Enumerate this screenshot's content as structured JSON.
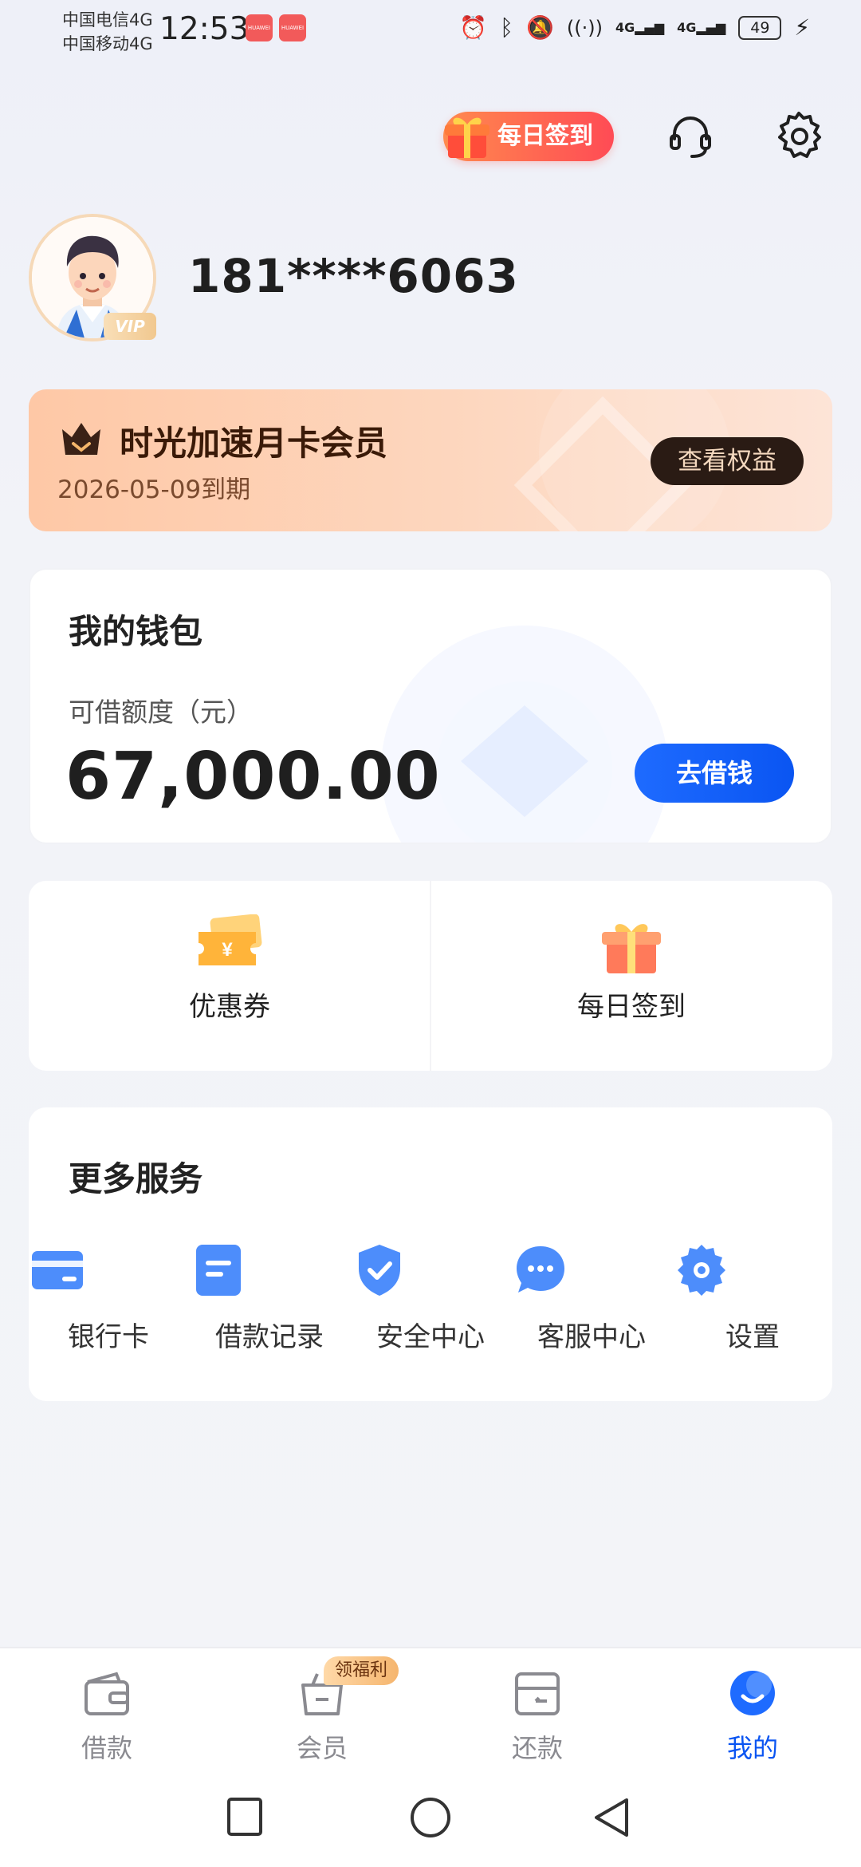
{
  "status_bar": {
    "carrier1": "中国电信4G",
    "carrier2": "中国移动4G",
    "time": "12:53",
    "notif1": "HUAWEI",
    "notif2": "HUAWEI",
    "battery": "49",
    "signal1": "4G",
    "signal2": "4G"
  },
  "header": {
    "daily_sign_label": "每日签到",
    "service_icon": "headset-icon",
    "settings_icon": "gear-icon"
  },
  "profile": {
    "phone": "181****6063",
    "vip_badge": "VIP"
  },
  "membership": {
    "title": "时光加速月卡会员",
    "expiry": "2026-05-09到期",
    "button": "查看权益"
  },
  "wallet": {
    "title": "我的钱包",
    "credit_label": "可借额度（元）",
    "amount": "67,000.00",
    "button": "去借钱"
  },
  "quick_actions": [
    {
      "label": "优惠券",
      "icon": "coupon-icon"
    },
    {
      "label": "每日签到",
      "icon": "gift-icon"
    }
  ],
  "services": {
    "title": "更多服务",
    "items": [
      {
        "label": "银行卡",
        "icon": "bank-card-icon"
      },
      {
        "label": "借款记录",
        "icon": "record-icon"
      },
      {
        "label": "安全中心",
        "icon": "shield-icon"
      },
      {
        "label": "客服中心",
        "icon": "chat-icon"
      },
      {
        "label": "设置",
        "icon": "gear-icon"
      }
    ]
  },
  "tabbar": {
    "badge": "领福利",
    "tabs": [
      {
        "label": "借款",
        "icon": "wallet-icon",
        "active": false
      },
      {
        "label": "会员",
        "icon": "basket-icon",
        "active": false
      },
      {
        "label": "还款",
        "icon": "repay-icon",
        "active": false
      },
      {
        "label": "我的",
        "icon": "profile-icon",
        "active": true
      }
    ]
  },
  "colors": {
    "accent": "#0a55f2",
    "sign_pill": "#ff5a55",
    "member_bg": "#fec8a6",
    "icon_blue": "#4d8dfb"
  }
}
